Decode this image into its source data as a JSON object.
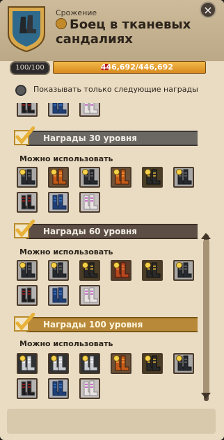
{
  "header": {
    "subtitle": "Срожение",
    "title": "Боец в тканевых сандалиях",
    "close_label": "×"
  },
  "stats": {
    "level": "100/100",
    "power": "446,692/446,692"
  },
  "filter": {
    "label": "Показывать только следующие награды"
  },
  "sections": [
    {
      "label": "Награды 30 уровня",
      "usable_label": "Можно использовать"
    },
    {
      "label": "Награды 60 уровня",
      "usable_label": "Можно использовать"
    },
    {
      "label": "Награды 100 уровня",
      "usable_label": "Можно использовать"
    }
  ],
  "colors": {
    "gray_band": "#6b6863",
    "dark_band": "#5c4e44",
    "gold_band": "#b9893a",
    "check": "#e8b23a"
  },
  "icons": {
    "close": "close-icon",
    "filter": "radio-toggle-icon",
    "section_check": "checkmark-icon",
    "item": "boots-icon",
    "power": "gem-icon"
  }
}
